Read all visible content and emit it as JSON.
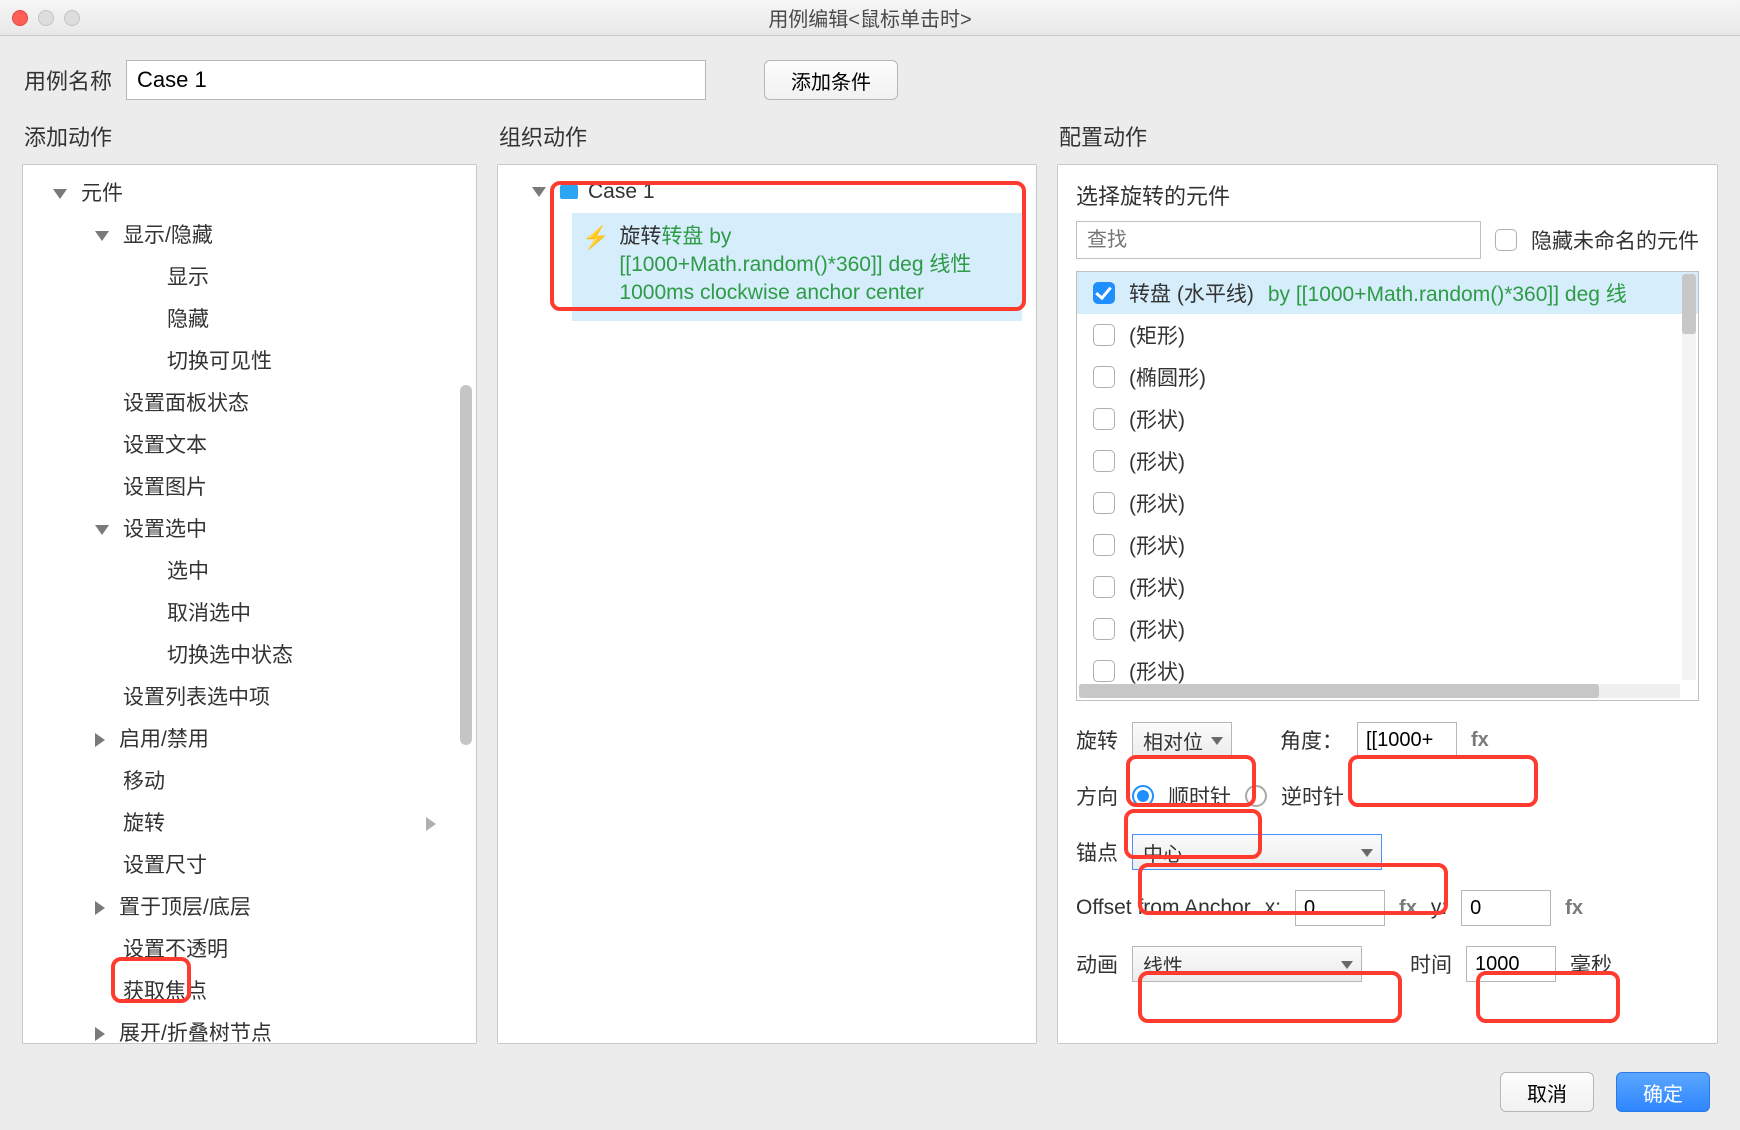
{
  "window": {
    "title": "用例编辑<鼠标单击时>"
  },
  "toprow": {
    "name_label": "用例名称",
    "name_value": "Case 1",
    "add_condition": "添加条件"
  },
  "columns": {
    "add_action": "添加动作",
    "organize_action": "组织动作",
    "configure_action": "配置动作"
  },
  "tree": {
    "root": "元件",
    "items": [
      {
        "label": "显示/隐藏",
        "depth": 2,
        "expand": "down"
      },
      {
        "label": "显示",
        "depth": 3
      },
      {
        "label": "隐藏",
        "depth": 3
      },
      {
        "label": "切换可见性",
        "depth": 3
      },
      {
        "label": "设置面板状态",
        "depth": 2
      },
      {
        "label": "设置文本",
        "depth": 2
      },
      {
        "label": "设置图片",
        "depth": 2
      },
      {
        "label": "设置选中",
        "depth": 2,
        "expand": "down"
      },
      {
        "label": "选中",
        "depth": 3
      },
      {
        "label": "取消选中",
        "depth": 3
      },
      {
        "label": "切换选中状态",
        "depth": 3
      },
      {
        "label": "设置列表选中项",
        "depth": 2
      },
      {
        "label": "启用/禁用",
        "depth": 2,
        "expand": "right"
      },
      {
        "label": "移动",
        "depth": 2
      },
      {
        "label": "旋转",
        "depth": 2,
        "submenu": true,
        "highlight": true
      },
      {
        "label": "设置尺寸",
        "depth": 2
      },
      {
        "label": "置于顶层/底层",
        "depth": 2,
        "expand": "right"
      },
      {
        "label": "设置不透明",
        "depth": 2
      },
      {
        "label": "获取焦点",
        "depth": 2
      },
      {
        "label": "展开/折叠树节点",
        "depth": 2,
        "expand": "right"
      }
    ]
  },
  "organize": {
    "case_label": "Case 1",
    "action_prefix": "旋转",
    "action_target": "转盘",
    "action_by": " by",
    "action_line2": "[[1000+Math.random()*360]] deg 线性",
    "action_line3": "1000ms clockwise anchor center"
  },
  "config": {
    "title": "选择旋转的元件",
    "search_placeholder": "查找",
    "hide_unnamed": "隐藏未命名的元件",
    "widgets": [
      {
        "label": "转盘 (水平线)",
        "suffix": " by [[1000+Math.random()*360]] deg 线",
        "checked": true
      },
      {
        "label": "(矩形)"
      },
      {
        "label": "(椭圆形)"
      },
      {
        "label": "(形状)"
      },
      {
        "label": "(形状)"
      },
      {
        "label": "(形状)"
      },
      {
        "label": "(形状)"
      },
      {
        "label": "(形状)"
      },
      {
        "label": "(形状)"
      },
      {
        "label": "(形状)"
      }
    ],
    "rotate_label": "旋转",
    "rotate_mode": "相对位",
    "angle_label": "角度：",
    "angle_value": "[[1000+",
    "direction_label": "方向",
    "clockwise": "顺时针",
    "counter_clockwise": "逆时针",
    "anchor_label": "锚点",
    "anchor_value": "中心",
    "offset_label": "Offset from Anchor",
    "x_label": "x:",
    "x_value": "0",
    "y_label": "y:",
    "y_value": "0",
    "anim_label": "动画",
    "anim_value": "线性",
    "time_label": "时间",
    "time_value": "1000",
    "time_unit": "毫秒",
    "fx": "fx"
  },
  "footer": {
    "cancel": "取消",
    "ok": "确定"
  }
}
